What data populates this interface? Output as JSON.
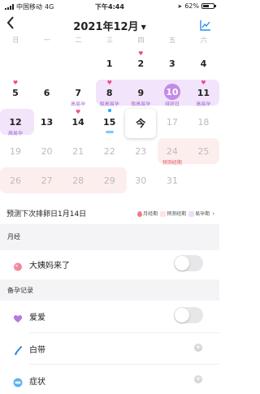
{
  "status_bar": {
    "carrier": "中国移动",
    "network": "4G",
    "time": "下午4:44",
    "battery_percent": "62%",
    "battery_level": 0.62
  },
  "header": {
    "title": "2021年12月",
    "back_icon": "chevron-left-icon",
    "title_caret_icon": "caret-down-icon",
    "stats_icon": "line-chart-icon"
  },
  "weekdays": [
    "日",
    "一",
    "二",
    "三",
    "四",
    "五",
    "六"
  ],
  "calendar": {
    "weeks": [
      [
        {
          "d": ""
        },
        {
          "d": ""
        },
        {
          "d": ""
        },
        {
          "d": "1"
        },
        {
          "d": "2",
          "heart": true
        },
        {
          "d": "3"
        },
        {
          "d": "4"
        }
      ],
      [
        {
          "d": "5",
          "heart": true
        },
        {
          "d": "6"
        },
        {
          "d": "7",
          "sub": "高易孕"
        },
        {
          "d": "8",
          "heart": true,
          "sub": "极高易孕"
        },
        {
          "d": "9",
          "sub": "极高易孕"
        },
        {
          "d": "10",
          "sub": "排卵日",
          "ovulation": true
        },
        {
          "d": "11",
          "heart": true,
          "sub": "高易孕"
        }
      ],
      [
        {
          "d": "12",
          "sub": "高易孕"
        },
        {
          "d": "13"
        },
        {
          "d": "14",
          "heart": true
        },
        {
          "d": "15",
          "dot": true
        },
        {
          "d": "今",
          "today": true
        },
        {
          "d": "17",
          "grey": true
        },
        {
          "d": "18",
          "grey": true
        }
      ],
      [
        {
          "d": "19",
          "grey": true
        },
        {
          "d": "20",
          "grey": true
        },
        {
          "d": "21",
          "grey": true
        },
        {
          "d": "22",
          "grey": true
        },
        {
          "d": "23",
          "grey": true
        },
        {
          "d": "24",
          "grey": true,
          "sub": "预测经期"
        },
        {
          "d": "25",
          "grey": true
        }
      ],
      [
        {
          "d": "26",
          "grey": true
        },
        {
          "d": "27",
          "grey": true
        },
        {
          "d": "28",
          "grey": true
        },
        {
          "d": "29",
          "grey": true
        },
        {
          "d": "30",
          "grey": true
        },
        {
          "d": "31",
          "grey": true
        },
        {
          "d": ""
        }
      ]
    ]
  },
  "prediction": {
    "text": "预测下次排卵日1月14日",
    "legend": [
      {
        "label": "月经期",
        "color": "#f07a88"
      },
      {
        "label": "预测经期",
        "color": "#fde3e3"
      },
      {
        "label": "易孕期",
        "color": "#eedcf9"
      }
    ],
    "more_icon": "chevron-right-icon"
  },
  "section_period": {
    "label": "月经",
    "row_label": "大姨妈来了",
    "icon": "drop-icon",
    "toggle_on": false
  },
  "section_records": {
    "label": "备孕记录",
    "rows": [
      {
        "label": "爱爱",
        "icon": "heart-icon",
        "control": "toggle"
      },
      {
        "label": "白带",
        "icon": "brush-icon",
        "control": "plus"
      },
      {
        "label": "症状",
        "icon": "face-icon",
        "control": "plus"
      }
    ]
  },
  "colors": {
    "fertile_band": "#f1e4fb",
    "predict_band": "#fdeeee",
    "ovulation": "#c38ae6",
    "heart": "#ea4d8e",
    "fertile_text": "#a368cf",
    "predict_text": "#e35c6a"
  }
}
